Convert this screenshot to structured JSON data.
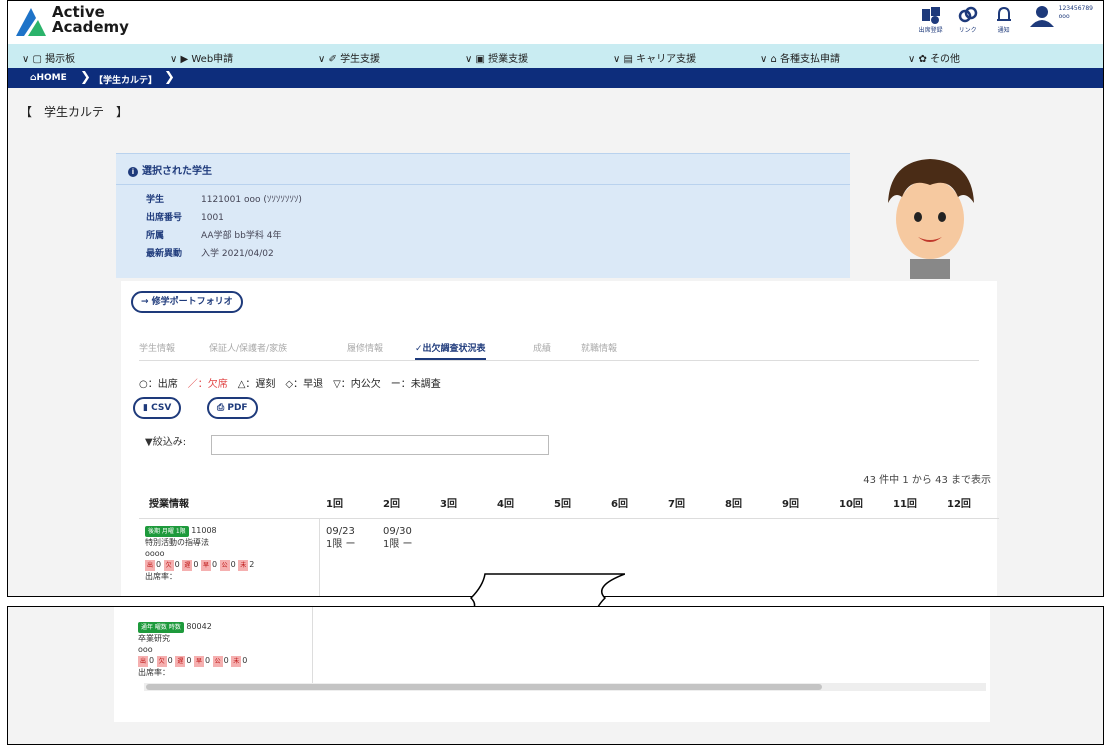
{
  "app": {
    "logo_line1": "Active",
    "logo_line2": "Academy"
  },
  "header": {
    "icons": [
      {
        "name": "attendance-register-icon",
        "label": "出席登録"
      },
      {
        "name": "link-icon",
        "label": "リンク"
      },
      {
        "name": "bell-icon",
        "label": "通知"
      }
    ],
    "user_id": "123456789",
    "user_name": "ooo"
  },
  "menu": [
    "掲示板",
    "Web申請",
    "学生支援",
    "授業支援",
    "キャリア支援",
    "各種支払申請",
    "その他"
  ],
  "breadcrumb": {
    "home": "HOME",
    "current": "【学生カルテ】"
  },
  "page_title": "【　学生カルテ　】",
  "selected_student": {
    "title": "選択された学生",
    "rows": [
      {
        "key": "学生",
        "value": "1121001 ooo (ｿｿｿｿｿｿｿ)"
      },
      {
        "key": "出席番号",
        "value": "1001"
      },
      {
        "key": "所属",
        "value": "AA学部 bb学科 4年"
      },
      {
        "key": "最新異動",
        "value": "入学 2021/04/02"
      }
    ]
  },
  "portfolio_button": "→ 修学ポートフォリオ",
  "tabs": [
    "学生情報",
    "保証人/保護者/家族",
    "履修情報",
    "✓出欠調査状況表",
    "成績",
    "就職情報"
  ],
  "active_tab": 3,
  "legend": {
    "present": "○：出席",
    "absent": "／：欠席",
    "rest": "△：遅刻　◇：早退　▽：内公欠　ー：未調査"
  },
  "buttons": {
    "csv": "CSV",
    "pdf": "PDF"
  },
  "filter": {
    "label": "▼絞込み:",
    "value": ""
  },
  "count_text": "43 件中 1 から 43 まで表示",
  "table": {
    "header_course": "授業情報",
    "sessions": [
      "1回",
      "2回",
      "3回",
      "4回",
      "5回",
      "6回",
      "7回",
      "8回",
      "9回",
      "10回",
      "11回",
      "12回"
    ],
    "rows": [
      {
        "badge": "後期 月曜 1限",
        "code": "11008",
        "name": "特別活動の指導法",
        "teacher": "oooo",
        "stats": [
          {
            "k": "出",
            "v": "0"
          },
          {
            "k": "欠",
            "v": "0"
          },
          {
            "k": "遅",
            "v": "0"
          },
          {
            "k": "早",
            "v": "0"
          },
          {
            "k": "公",
            "v": "0"
          },
          {
            "k": "未",
            "v": "2"
          }
        ],
        "rate": "出席率：",
        "cells": [
          {
            "date": "09/23",
            "period": "1限 ー"
          },
          {
            "date": "09/30",
            "period": "1限 ー"
          }
        ]
      },
      {
        "badge": "通年 曜数 時数",
        "code": "80042",
        "name": "卒業研究",
        "teacher": "ooo",
        "stats": [
          {
            "k": "出",
            "v": "0"
          },
          {
            "k": "欠",
            "v": "0"
          },
          {
            "k": "遅",
            "v": "0"
          },
          {
            "k": "早",
            "v": "0"
          },
          {
            "k": "公",
            "v": "0"
          },
          {
            "k": "未",
            "v": "0"
          }
        ],
        "rate": "出席率：",
        "cells": []
      }
    ]
  },
  "colors": {
    "navy": "#0d2d7c",
    "menu_bg": "#c9ecf2",
    "panel_bg": "#dbe9f7",
    "absent": "#e04040",
    "badge": "#1e9a3c"
  }
}
